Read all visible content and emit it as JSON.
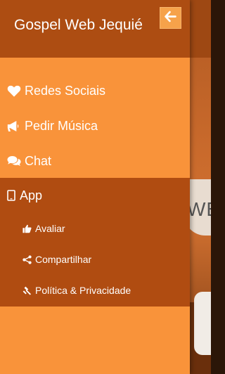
{
  "drawer": {
    "title": "Gospel Web Jequié",
    "back_icon": "arrow-left-icon"
  },
  "menu": [
    {
      "label": "Redes Sociais",
      "icon": "heart-icon"
    },
    {
      "label": "Pedir Música",
      "icon": "megaphone-icon"
    },
    {
      "label": "Chat",
      "icon": "comments-icon"
    }
  ],
  "app_section": {
    "label": "App",
    "icon": "mobile-icon",
    "items": [
      {
        "label": "Avaliar",
        "icon": "thumbs-up-icon"
      },
      {
        "label": "Compartilhar",
        "icon": "share-icon"
      },
      {
        "label": "Política & Privacidade",
        "icon": "gavel-icon"
      }
    ]
  },
  "background": {
    "visible_text": "WE"
  },
  "colors": {
    "drawer_bg": "#f9933a",
    "header_bg": "#ad4d12",
    "app_section_bg": "#b04c11",
    "text": "#ffffff"
  }
}
